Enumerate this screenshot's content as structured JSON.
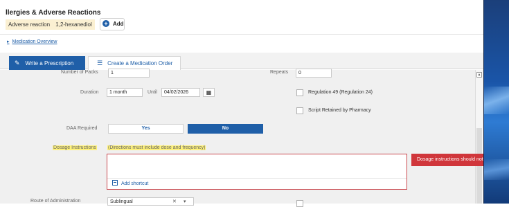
{
  "allergies": {
    "title": "llergies & Adverse Reactions",
    "reaction_type": "Adverse reaction",
    "substance": "1,2-hexanediol",
    "add_label": "Add"
  },
  "medication_overview": {
    "link_label": "Medication Overview"
  },
  "tabs": [
    {
      "label": "Write a Prescription",
      "active": true,
      "icon": "pencil-icon"
    },
    {
      "label": "Create a Medication Order",
      "active": false,
      "icon": "list-icon"
    }
  ],
  "form": {
    "number_of_packs": {
      "label": "Number of Packs",
      "value": "1"
    },
    "repeats": {
      "label": "Repeats",
      "value": "0"
    },
    "duration": {
      "label": "Duration",
      "value": "1 month"
    },
    "until": {
      "label": "Until",
      "value": "04/02/2026"
    },
    "regulation_49": {
      "label": "Regulation 49 (Regulation 24)",
      "checked": false
    },
    "script_retained": {
      "label": "Script Retained by Pharmacy",
      "checked": false
    },
    "daa_required": {
      "label": "DAA Required",
      "yes_label": "Yes",
      "no_label": "No",
      "selected": "No"
    },
    "dosage": {
      "label": "Dosage Instructions",
      "hint": "(Directions must include dose and frequency)",
      "value": "",
      "shortcut_label": "Add shortcut",
      "error": "Dosage instructions should not be em"
    },
    "route": {
      "label": "Route of Administration",
      "value": "Sublingual"
    }
  },
  "colors": {
    "accent": "#1f5fa8",
    "error": "#d0363b",
    "highlight": "#fff27a",
    "chip": "#fbf0d2"
  }
}
